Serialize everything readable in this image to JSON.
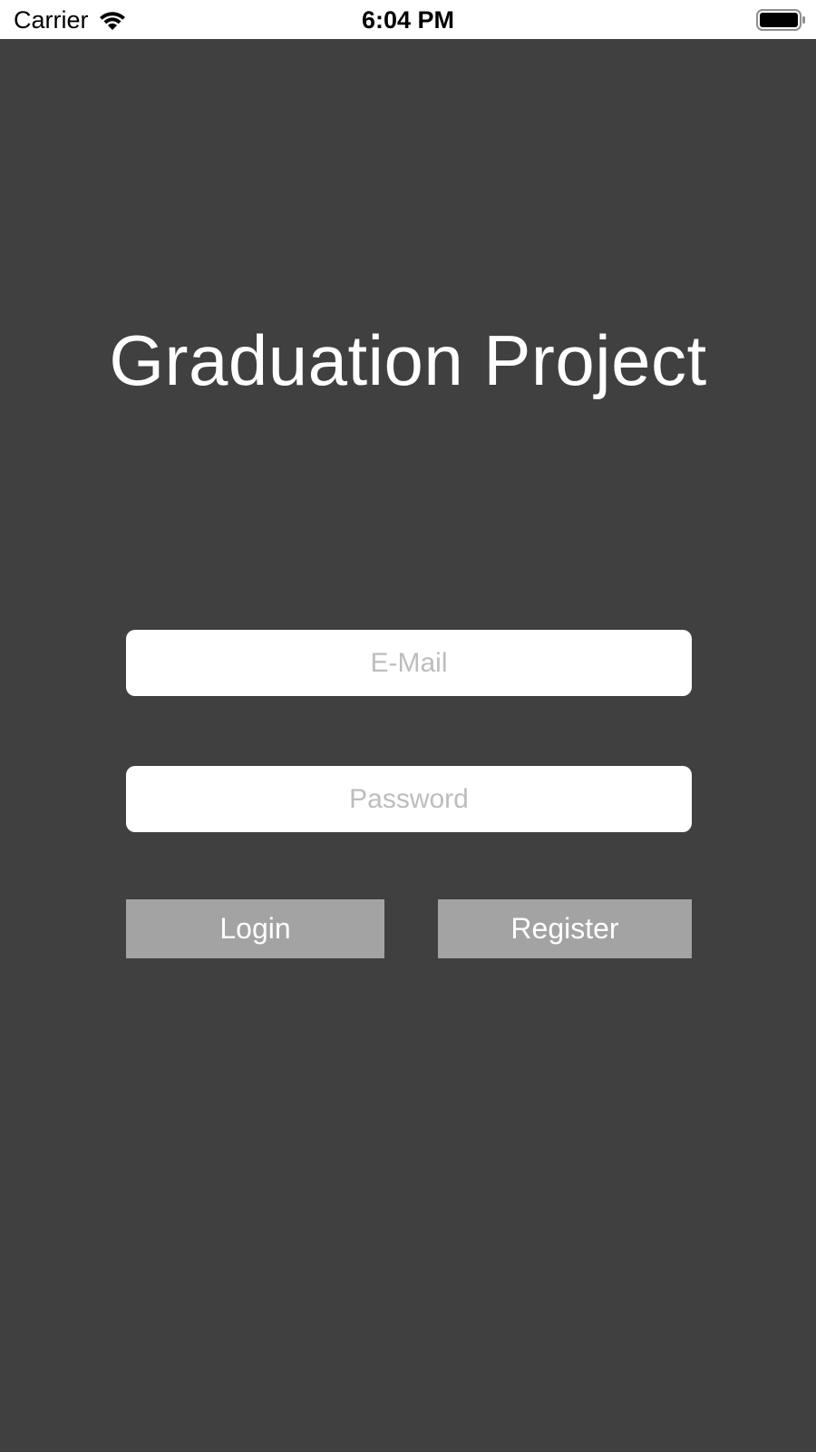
{
  "status_bar": {
    "carrier": "Carrier",
    "time": "6:04 PM",
    "icons": [
      "wifi-icon",
      "battery-icon"
    ]
  },
  "app": {
    "title": "Graduation Project",
    "background_color": "#404040"
  },
  "form": {
    "email_placeholder": "E-Mail",
    "email_value": "",
    "password_placeholder": "Password",
    "password_value": ""
  },
  "buttons": {
    "login_label": "Login",
    "register_label": "Register",
    "button_color": "#a3a3a3"
  }
}
